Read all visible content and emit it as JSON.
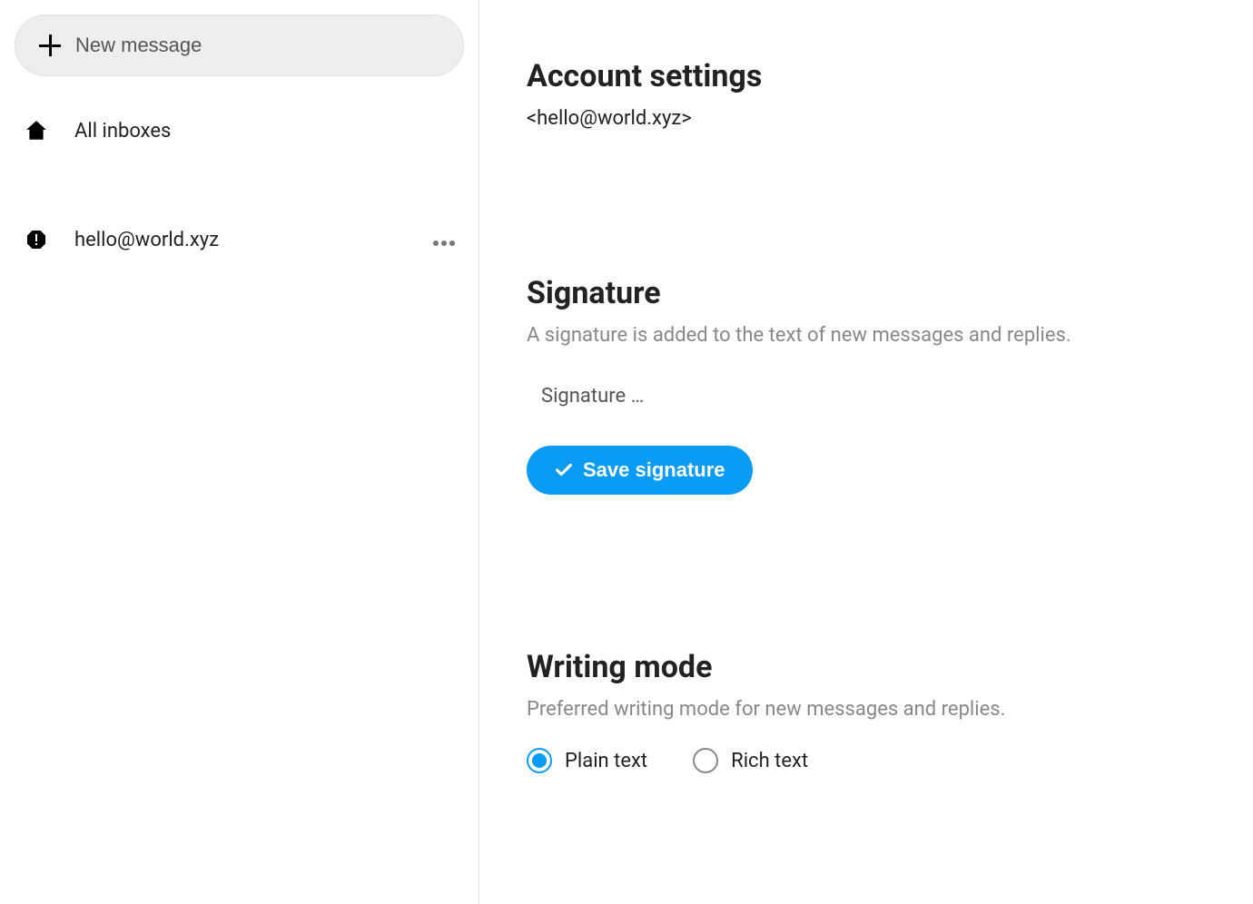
{
  "sidebar": {
    "new_message_label": "New message",
    "all_inboxes_label": "All inboxes",
    "account_label": "hello@world.xyz"
  },
  "main": {
    "account_settings_heading": "Account settings",
    "account_email": "<hello@world.xyz>",
    "signature_heading": "Signature",
    "signature_sub": "A signature is added to the text of new messages and replies.",
    "signature_placeholder": "Signature …",
    "save_signature_label": "Save signature",
    "writing_mode_heading": "Writing mode",
    "writing_mode_sub": "Preferred writing mode for new messages and replies.",
    "writing_mode_options": {
      "plain": "Plain text",
      "rich": "Rich text"
    },
    "writing_mode_selected": "plain"
  }
}
